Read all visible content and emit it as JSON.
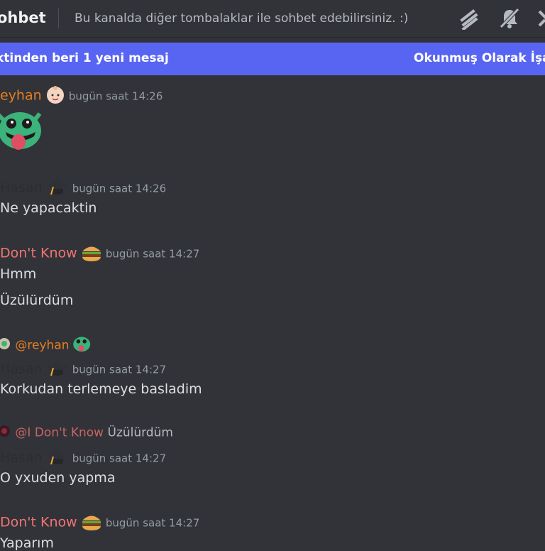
{
  "header": {
    "channel_name": "ohbet",
    "topic": "Bu kanalda diğer tombalaklar ile sohbet edebilirsiniz. :)"
  },
  "new_messages_bar": {
    "left_text": "ktinden beri 1 yeni mesaj",
    "right_text": "Okunmuş Olarak İşare"
  },
  "colors": {
    "background": "#313338",
    "accent": "#5865f2",
    "reyhan": "#e67e22",
    "idontknow": "#f07474",
    "hasan": "#2b2d31",
    "timestamp": "#949ba4"
  },
  "messages": [
    {
      "author": "eyhan",
      "timestamp": "bugün saat 14:26",
      "badge_icon": "baby-face-icon",
      "content": ""
    },
    {
      "author": "Hasan",
      "timestamp": "bugün saat 14:26",
      "badge_icon": "graduation-cap-icon",
      "content": "Ne yapacaktin"
    },
    {
      "author": "Don't Know",
      "timestamp": "bugün saat 14:27",
      "badge_icon": "hamburger-icon",
      "content": "Hmm",
      "content2": "Üzülürdüm"
    },
    {
      "reply_to": "@reyhan",
      "author": "Hasan",
      "timestamp": "bugün saat 14:27",
      "badge_icon": "graduation-cap-icon",
      "content": "Korkudan terlemeye basladim"
    },
    {
      "reply_to": "@I Don't Know",
      "reply_text": "Üzülürdüm",
      "author": "Hasan",
      "timestamp": "bugün saat 14:27",
      "badge_icon": "graduation-cap-icon",
      "content": "O yxuden yapma"
    },
    {
      "author": "Don't Know",
      "timestamp": "bugün saat 14:27",
      "badge_icon": "hamburger-icon",
      "content": "Yaparım"
    }
  ]
}
